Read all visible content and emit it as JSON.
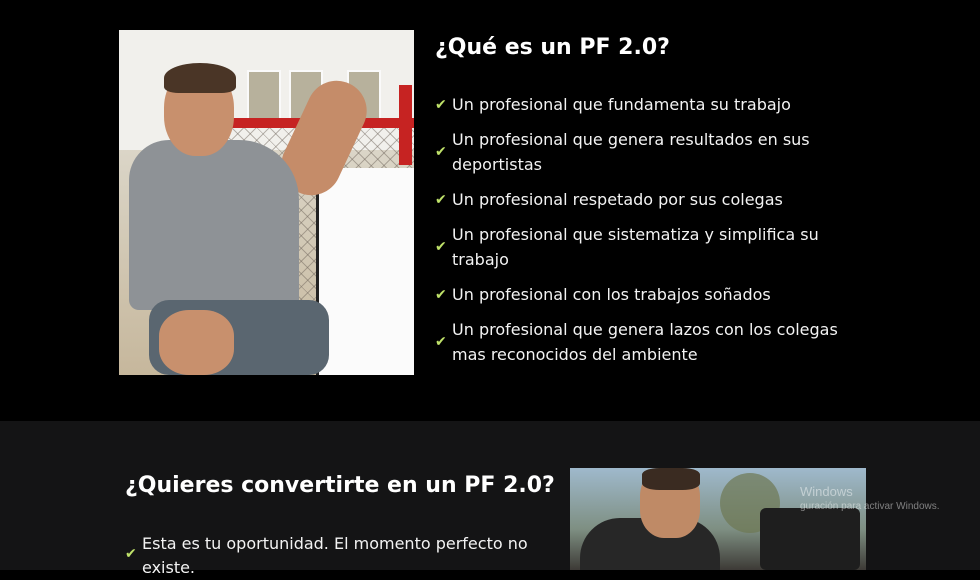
{
  "section1": {
    "title": "¿Qué es un PF 2.0?",
    "check_icon": "check-icon",
    "accent_color": "#bfe26a",
    "items": [
      "Un profesional que fundamenta su trabajo",
      "Un profesional que genera resultados en sus deportistas",
      "Un profesional respetado por sus colegas",
      "Un profesional que sistematiza y simplifica su trabajo",
      "Un profesional con los trabajos soñados",
      "Un profesional que genera lazos con los colegas mas reconocidos del ambiente"
    ]
  },
  "section2": {
    "title": "¿Quieres convertirte en un PF 2.0?",
    "items": [
      "Esta es tu oportunidad. El momento perfecto no existe."
    ]
  },
  "watermark": {
    "line1": "Windows",
    "line2": "guración para activar Windows."
  }
}
